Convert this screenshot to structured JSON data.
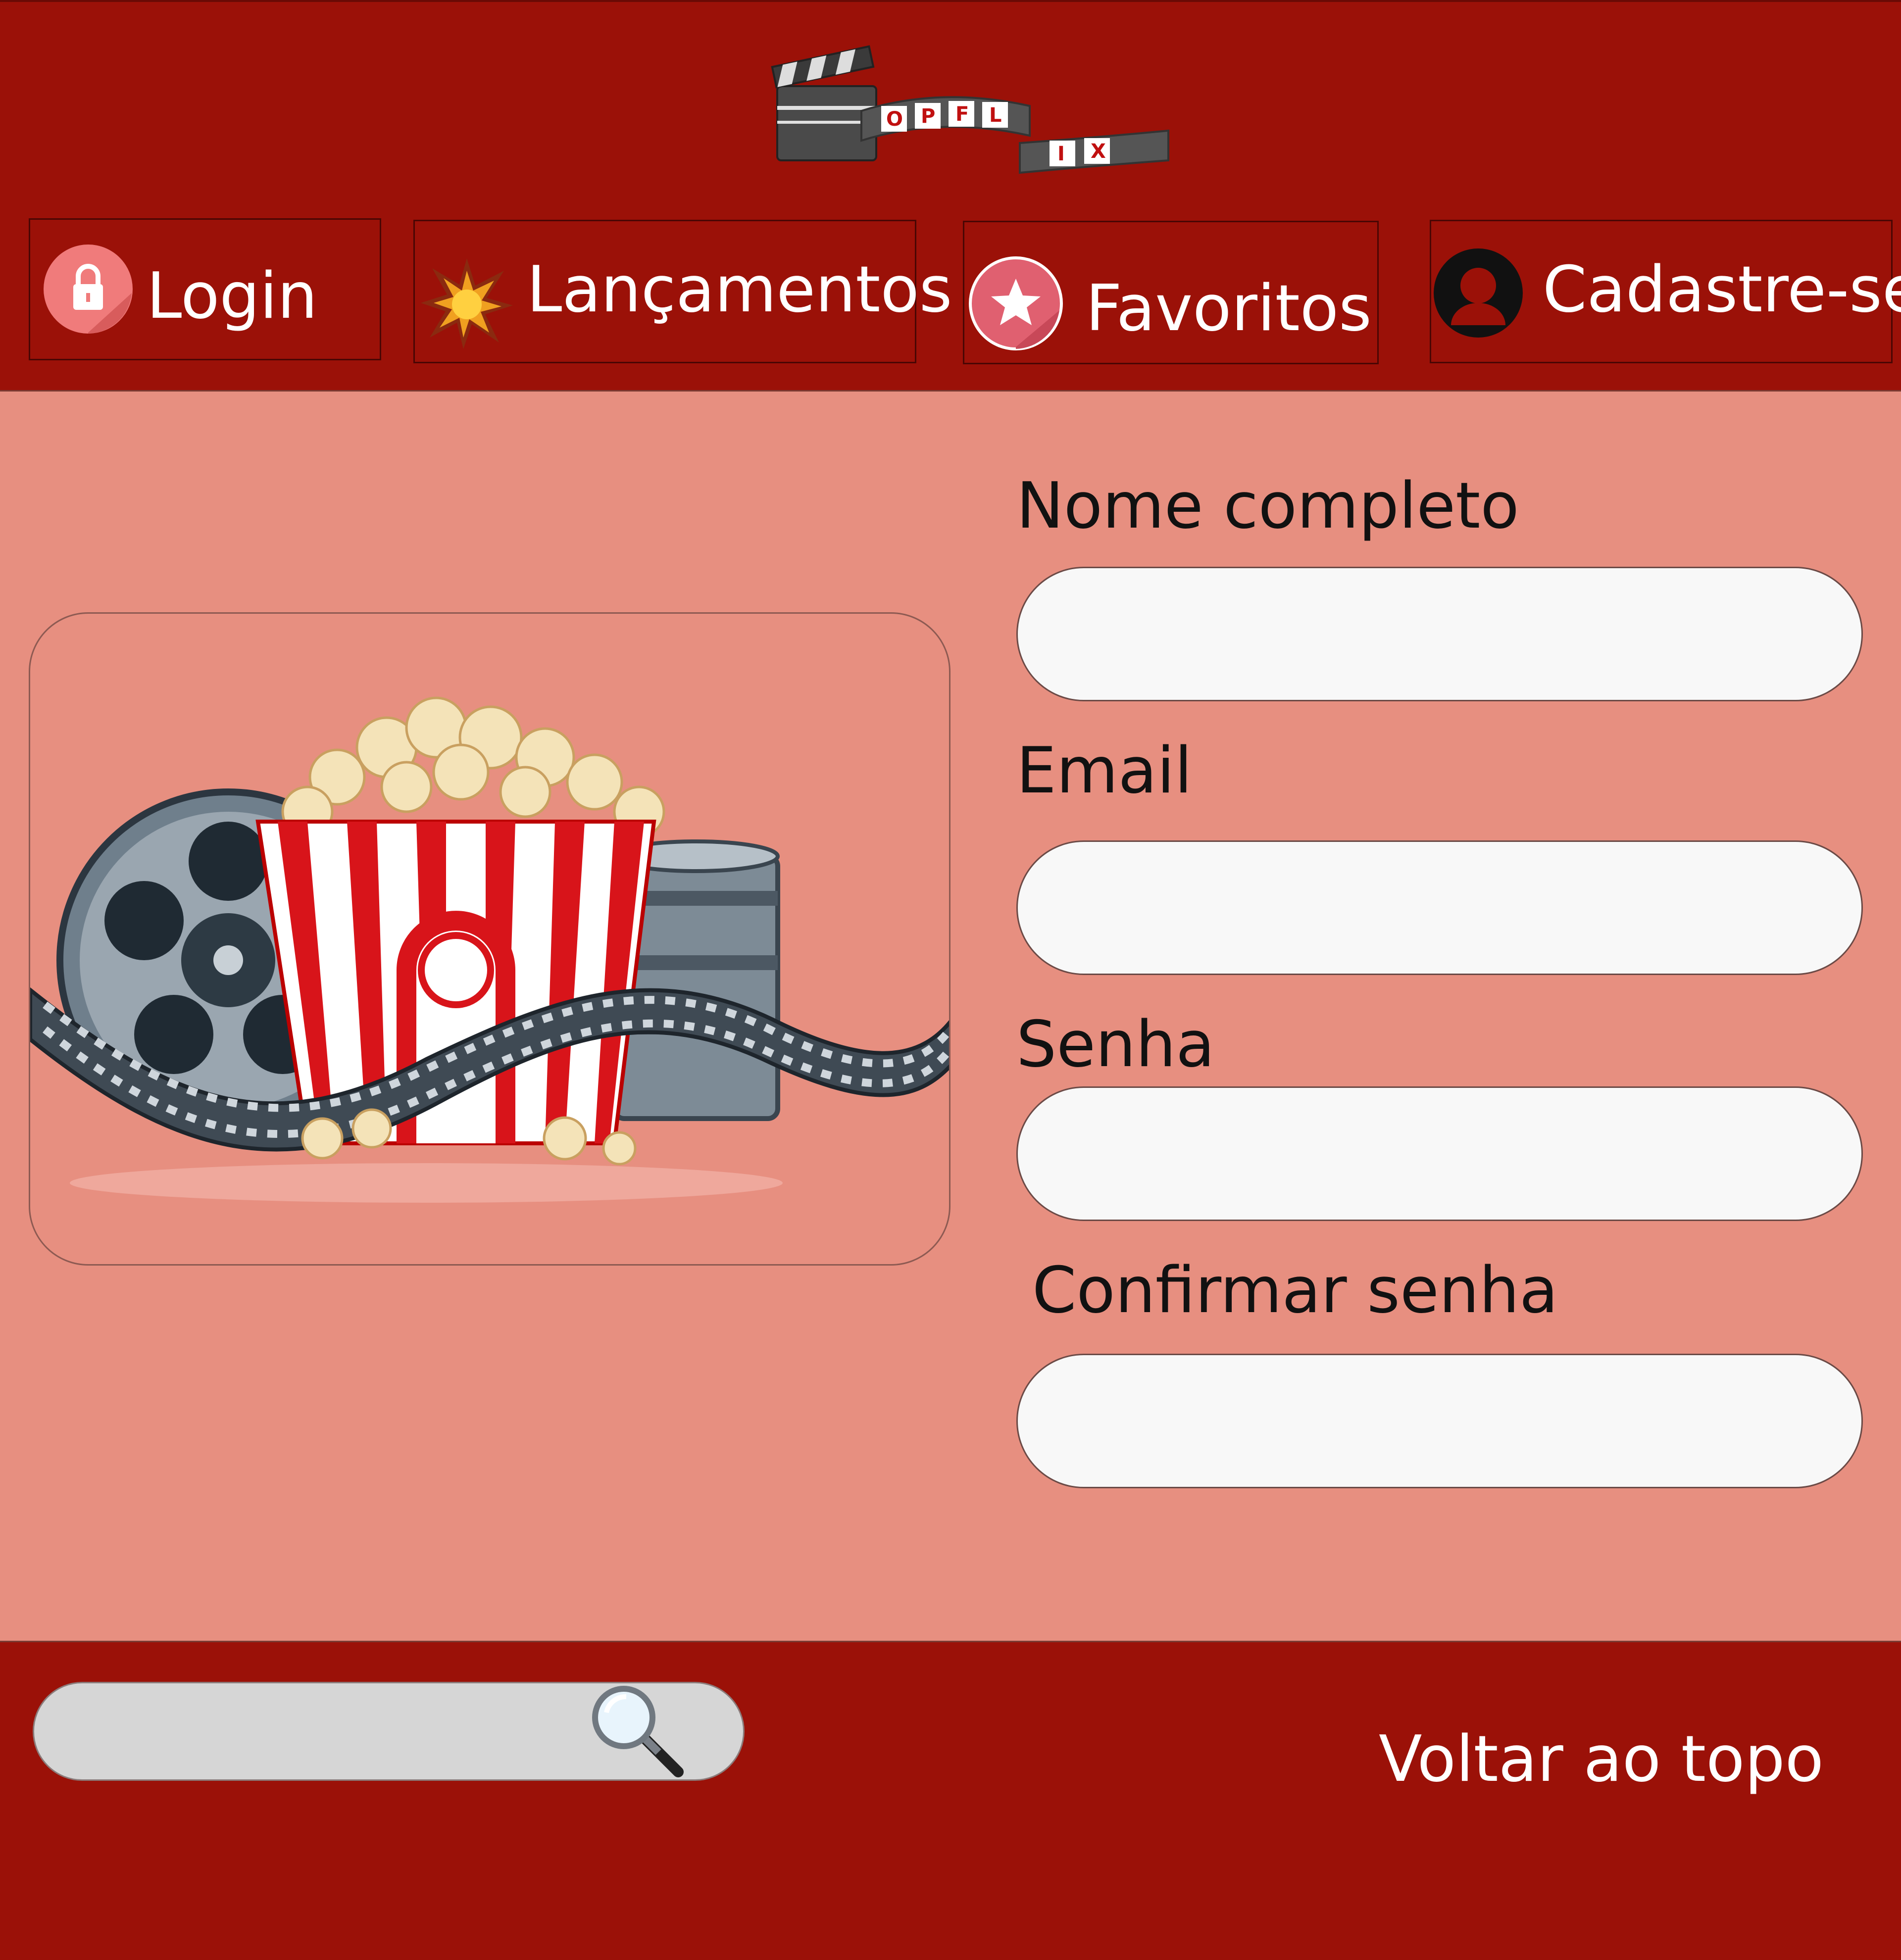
{
  "brand": {
    "logo_letters": [
      "O",
      "P",
      "F",
      "L",
      "I",
      "X"
    ],
    "primary_color": "#9b1108",
    "content_bg": "#e78f80"
  },
  "nav": [
    {
      "label": "Login",
      "icon": "lock-icon"
    },
    {
      "label": "Lançamentos",
      "icon": "explosion-icon"
    },
    {
      "label": "Favoritos",
      "icon": "star-icon"
    },
    {
      "label": "Cadastre-se",
      "icon": "user-icon"
    }
  ],
  "form": {
    "name_label": "Nome completo",
    "email_label": "Email",
    "password_label": "Senha",
    "confirm_label": "Confirmar senha",
    "name_value": "",
    "email_value": "",
    "password_value": "",
    "confirm_value": ""
  },
  "footer": {
    "search_value": "",
    "back_to_top": "Voltar ao topo"
  }
}
